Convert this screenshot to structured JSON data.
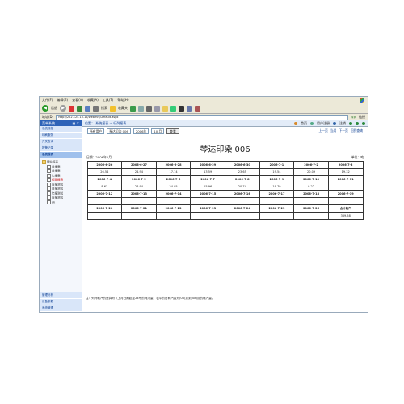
{
  "menubar": {
    "items": [
      "文件(F)",
      "编辑(E)",
      "查看(V)",
      "收藏(A)",
      "工具(T)",
      "帮助(H)"
    ]
  },
  "toolbar": {
    "back_label": "后退",
    "search_label": "搜索",
    "favorites_label": "收藏夹"
  },
  "addressbar": {
    "label": "地址(D)",
    "url": "http://222.124.10.16/webmis/Default.aspx",
    "go_label": "转到",
    "links_label": "链接"
  },
  "sidebar": {
    "header": "菜单系统",
    "controls": "▣ ✕",
    "nav": [
      "系统流程",
      "印刷服务",
      "开关查询",
      "报警记录",
      "系统报表"
    ],
    "tree": {
      "root": "理业报表",
      "children": [
        "日报表",
        "月报表",
        "年报表",
        "行政报表",
        "日报测试",
        "月报测试",
        "年报测试",
        "日报测试",
        "ok"
      ]
    },
    "bottom": [
      "管理分析",
      "设备参数",
      "系统管理"
    ]
  },
  "main": {
    "breadcrumb": [
      "位置：",
      "系统报表",
      "→",
      "行列报表"
    ],
    "header_actions": [
      "首页",
      "用户注册",
      "注销"
    ],
    "filters": {
      "company": "所有用户",
      "meter": "琴达印染 006",
      "year": "2006年",
      "month": "10 月",
      "query_label": "查看"
    },
    "pager": [
      "上一页",
      "当月",
      "下一页"
    ],
    "back_label": "回到查询",
    "report_title": "琴达印染  006",
    "date_label": "日期：2006年1月",
    "unit_label": "单位：吨",
    "table": [
      [
        "2006-6-26",
        "2006-6-27",
        "2006-6-28",
        "2006-6-29",
        "2006-6-30",
        "2006-7-1",
        "2006-7-2",
        "2006-7-3"
      ],
      [
        "26.54",
        "24.94",
        "17.74",
        "13.59",
        "23.65",
        "19.54",
        "20.09",
        "19.32"
      ],
      [
        "2006-7-4",
        "2006-7-5",
        "2006-7-6",
        "2006-7-7",
        "2006-7-8",
        "2006-7-9",
        "2006-7-10",
        "2006-7-11"
      ],
      [
        "8.63",
        "26.94",
        "24.05",
        "15.96",
        "20.74",
        "19.79",
        "0.22",
        ""
      ],
      [
        "2006-7-12",
        "2006-7-13",
        "2006-7-14",
        "2006-7-15",
        "2006-7-16",
        "2006-7-17",
        "2006-7-18",
        "2006-7-19"
      ],
      [
        "",
        "",
        "",
        "",
        "",
        "",
        "",
        ""
      ],
      [
        "2006-7-20",
        "2006-7-21",
        "2006-7-22",
        "2006-7-23",
        "2006-7-24",
        "2006-7-25",
        "2006-7-26",
        "合计耗汽"
      ],
      [
        "",
        "",
        "",
        "",
        "",
        "",
        "",
        "389.58"
      ]
    ],
    "note": "注：列列耗汽的是算为（上月日期起至24号的耗汽量，表中的日耗汽量为(08)点到(08)点的耗汽量。"
  }
}
